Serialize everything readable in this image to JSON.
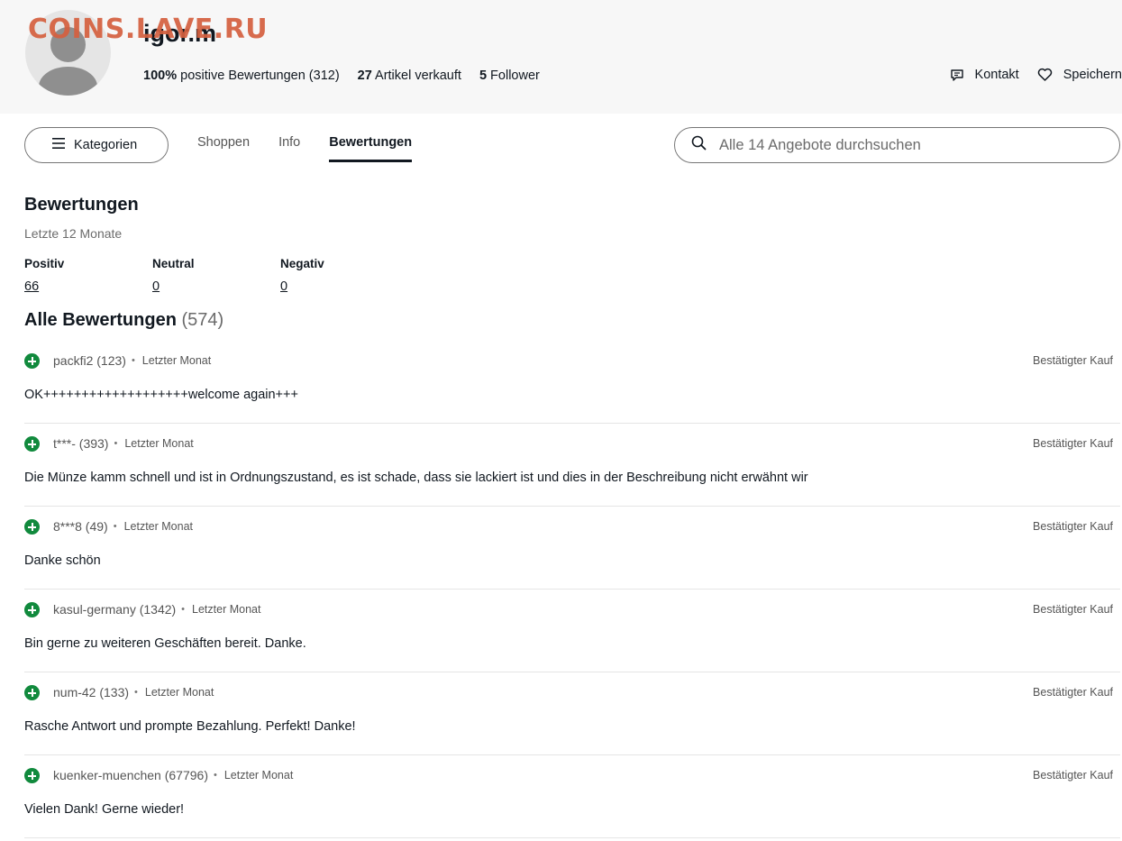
{
  "watermark": "COINS.LAVE.RU",
  "seller": {
    "name": "igor.m",
    "stats": [
      {
        "value": "100%",
        "label": "positive Bewertungen (312)"
      },
      {
        "value": "27",
        "label": "Artikel verkauft"
      },
      {
        "value": "5",
        "label": "Follower"
      }
    ],
    "contact_label": "Kontakt",
    "save_label": "Speichern"
  },
  "nav": {
    "categories_label": "Kategorien",
    "tabs": [
      {
        "label": "Shoppen",
        "active": false
      },
      {
        "label": "Info",
        "active": false
      },
      {
        "label": "Bewertungen",
        "active": true
      }
    ],
    "search_placeholder": "Alle 14 Angebote durchsuchen"
  },
  "ratings": {
    "title": "Bewertungen",
    "subtitle": "Letzte 12 Monate",
    "positive_label": "Positiv",
    "positive_count": "66",
    "neutral_label": "Neutral",
    "neutral_count": "0",
    "negative_label": "Negativ",
    "negative_count": "0"
  },
  "all_reviews": {
    "title": "Alle Bewertungen",
    "count": "(574)",
    "items": [
      {
        "user": "packfi2 (123)",
        "when": "Letzter Monat",
        "badge": "Bestätigter Kauf",
        "text": "OK+++++++++++++++++++welcome again+++"
      },
      {
        "user": "t***- (393)",
        "when": "Letzter Monat",
        "badge": "Bestätigter Kauf",
        "text": "Die Münze kamm schnell und ist in Ordnungszustand, es ist schade, dass sie lackiert ist und dies in der Beschreibung nicht erwähnt wir"
      },
      {
        "user": "8***8 (49)",
        "when": "Letzter Monat",
        "badge": "Bestätigter Kauf",
        "text": "Danke schön"
      },
      {
        "user": "kasul-germany (1342)",
        "when": "Letzter Monat",
        "badge": "Bestätigter Kauf",
        "text": "Bin gerne zu weiteren Geschäften bereit. Danke."
      },
      {
        "user": "num-42 (133)",
        "when": "Letzter Monat",
        "badge": "Bestätigter Kauf",
        "text": "Rasche Antwort und prompte Bezahlung. Perfekt! Danke!"
      },
      {
        "user": "kuenker-muenchen (67796)",
        "when": "Letzter Monat",
        "badge": "Bestätigter Kauf",
        "text": "Vielen Dank! Gerne wieder!"
      }
    ]
  },
  "colors": {
    "positive_green": "#118a3d",
    "watermark_orange": "#d5603f",
    "header_bg": "#f7f7f7"
  }
}
